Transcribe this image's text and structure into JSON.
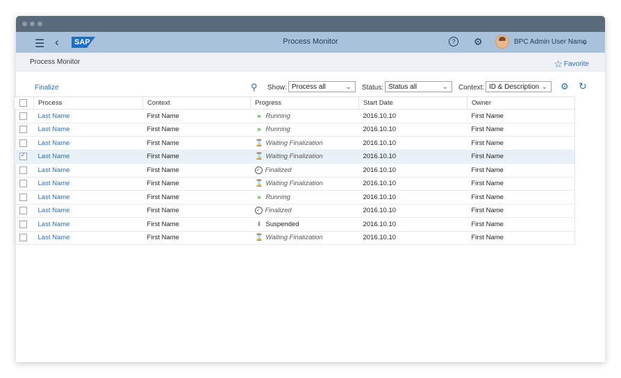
{
  "shell": {
    "logo": "SAP",
    "title": "Process Monitor",
    "user": "BPC Admin User Name"
  },
  "subheader": {
    "breadcrumb": "Process Monitor",
    "favorite": "Favorite"
  },
  "toolbar": {
    "finalize": "Finalize",
    "show_label": "Show:",
    "show_value": "Process all",
    "status_label": "Status:",
    "status_value": "Status all",
    "context_label": "Context:",
    "context_value": "ID & Description"
  },
  "table": {
    "columns": [
      "Process",
      "Context",
      "Progress",
      "Start Date",
      "Owner"
    ],
    "rows": [
      {
        "process": "Last Name",
        "context": "First Name",
        "progress": "Running",
        "state": "running",
        "start": "2016.10.10",
        "owner": "First Name",
        "checked": false
      },
      {
        "process": "Last Name",
        "context": "First Name",
        "progress": "Running",
        "state": "running",
        "start": "2016.10.10",
        "owner": "First Name",
        "checked": false
      },
      {
        "process": "Last Name",
        "context": "First Name",
        "progress": "Waiting Finalization",
        "state": "waiting",
        "start": "2016.10.10",
        "owner": "First Name",
        "checked": false
      },
      {
        "process": "Last Name",
        "context": "First Name",
        "progress": "Waiting Finalization",
        "state": "waiting",
        "start": "2016.10.10",
        "owner": "First Name",
        "checked": true
      },
      {
        "process": "Last Name",
        "context": "First Name",
        "progress": "Finalized",
        "state": "finalized",
        "start": "2016.10.10",
        "owner": "First Name",
        "checked": false
      },
      {
        "process": "Last Name",
        "context": "First Name",
        "progress": "Waiting Finalization",
        "state": "waiting",
        "start": "2016.10.10",
        "owner": "First Name",
        "checked": false
      },
      {
        "process": "Last Name",
        "context": "First Name",
        "progress": "Running",
        "state": "running",
        "start": "2016.10.10",
        "owner": "First Name",
        "checked": false
      },
      {
        "process": "Last Name",
        "context": "First Name",
        "progress": "Finalized",
        "state": "finalized",
        "start": "2016.10.10",
        "owner": "First Name",
        "checked": false
      },
      {
        "process": "Last Name",
        "context": "First Name",
        "progress": "Suspended",
        "state": "suspended",
        "start": "2016.10.10",
        "owner": "First Name",
        "checked": false
      },
      {
        "process": "Last Name",
        "context": "First Name",
        "progress": "Waiting Finalization",
        "state": "waiting",
        "start": "2016.10.10",
        "owner": "First Name",
        "checked": false
      }
    ]
  },
  "icons": {
    "running": "running-icon",
    "waiting": "hourglass-icon",
    "finalized": "check-circle-icon",
    "suspended": "pause-icon"
  },
  "colors": {
    "shell_bg": "#a9c2db",
    "link": "#2b6fb3",
    "running": "#3d9a2a"
  }
}
